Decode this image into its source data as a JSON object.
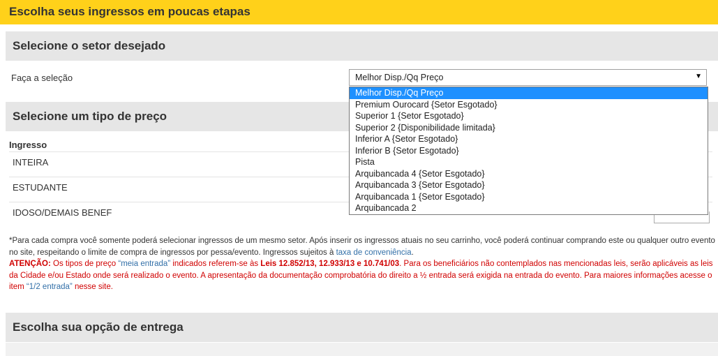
{
  "header": {
    "title": "Escolha seus ingressos em poucas etapas"
  },
  "sector": {
    "heading": "Selecione o setor desejado",
    "label": "Faça a seleção",
    "selected": "Melhor Disp./Qq Preço",
    "arrow": "▼",
    "options": [
      "Melhor Disp./Qq Preço",
      "Premium Ourocard {Setor Esgotado}",
      "Superior 1 {Setor Esgotado}",
      "Superior 2 {Disponibilidade limitada}",
      "Inferior A {Setor Esgotado}",
      "Inferior B {Setor Esgotado}",
      "Pista",
      "Arquibancada 4 {Setor Esgotado}",
      "Arquibancada 3 {Setor Esgotado}",
      "Arquibancada 1 {Setor Esgotado}",
      "Arquibancada 2"
    ]
  },
  "price": {
    "heading": "Selecione um tipo de preço",
    "column_header": "Ingresso",
    "rows": [
      "INTEIRA",
      "ESTUDANTE",
      "IDOSO/DEMAIS BENEF"
    ]
  },
  "notes": {
    "p1": "*Para cada compra você somente poderá selecionar ingressos de um mesmo setor. Após inserir os ingressos atuais no seu carrinho, você poderá continuar comprando este ou qualquer outro evento no site, respeitando o limite de compra de ingressos por pessa/evento. Ingressos sujeitos à ",
    "p1_link": "taxa de conveniência",
    "p1_end": ".",
    "attention_label": "ATENÇÃO:",
    "a1": " Os tipos de preço ",
    "a1_quote": "“meia entrada”",
    "a2": " indicados referem-se às ",
    "laws": "Leis 12.852/13, 12.933/13 e 10.741/03",
    "a3": ". Para os beneficiários não contemplados nas mencionadas leis, serão aplicáveis as leis da Cidade e/ou Estado onde será realizado o evento. A apresentação da documentação comprobatória do direito a ½ entrada será exigida na entrada do evento. Para maiores informações acesse o item ",
    "a3_quote": "“1/2 entrada”",
    "a4": " nesse site."
  },
  "delivery": {
    "heading": "Escolha sua opção de entrega"
  }
}
